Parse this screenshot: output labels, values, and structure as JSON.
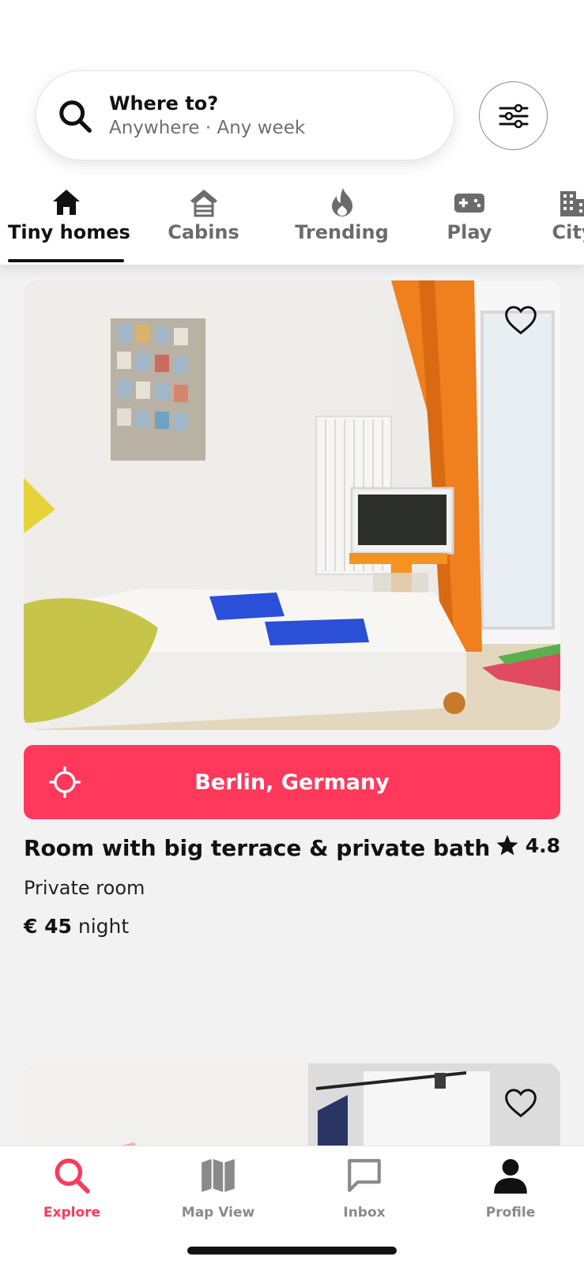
{
  "search": {
    "title": "Where to?",
    "subtitle": "Anywhere · Any week"
  },
  "categories": [
    {
      "label": "Tiny homes",
      "icon": "home-icon",
      "active": true
    },
    {
      "label": "Cabins",
      "icon": "cabin-icon"
    },
    {
      "label": "Trending",
      "icon": "flame-icon"
    },
    {
      "label": "Play",
      "icon": "gamepad-icon"
    },
    {
      "label": "City",
      "icon": "city-icon"
    }
  ],
  "listing": {
    "location": "Berlin, Germany",
    "title": "Room with big terrace & private bath",
    "rating": "4.8",
    "type": "Private room",
    "price": "€ 45",
    "price_unit": "night"
  },
  "nav": [
    {
      "label": "Explore",
      "icon": "search-icon",
      "active": true
    },
    {
      "label": "Map View",
      "icon": "map-icon"
    },
    {
      "label": "Inbox",
      "icon": "chat-icon"
    },
    {
      "label": "Profile",
      "icon": "person-icon"
    }
  ],
  "colors": {
    "accent": "#ff385c",
    "text": "#111111",
    "muted": "#6b6b6b",
    "background": "#f2f2f2"
  }
}
